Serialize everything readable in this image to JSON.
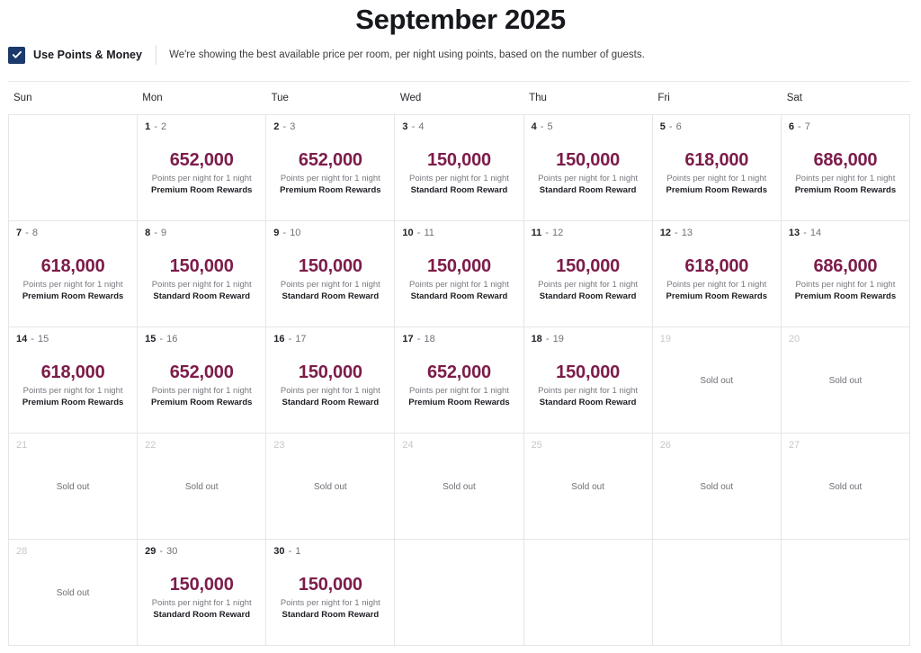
{
  "header": {
    "month_title": "September 2025"
  },
  "points_bar": {
    "checkbox_checked": true,
    "checkbox_icon": "checkmark-icon",
    "label": "Use Points & Money",
    "description": "We're showing the best available price per room, per night using points, based on the number of guests."
  },
  "weekdays": [
    "Sun",
    "Mon",
    "Tue",
    "Wed",
    "Thu",
    "Fri",
    "Sat"
  ],
  "labels": {
    "points_sub": "Points per night for 1 night",
    "sold_out": "Sold out",
    "premium_room": "Premium Room Rewards",
    "standard_room": "Standard Room Reward"
  },
  "colors": {
    "price": "#7c1c4a",
    "checkbox": "#1b3a6b",
    "grid_line": "#e6e6e8",
    "muted_text": "#c6c7cb"
  },
  "calendar": {
    "weeks": [
      [
        {
          "type": "empty"
        },
        {
          "type": "price",
          "day_start": "1",
          "day_end": "2",
          "price": "652,000",
          "sub": "Points per night for 1 night",
          "room": "Premium Room Rewards"
        },
        {
          "type": "price",
          "day_start": "2",
          "day_end": "3",
          "price": "652,000",
          "sub": "Points per night for 1 night",
          "room": "Premium Room Rewards"
        },
        {
          "type": "price",
          "day_start": "3",
          "day_end": "4",
          "price": "150,000",
          "sub": "Points per night for 1 night",
          "room": "Standard Room Reward"
        },
        {
          "type": "price",
          "day_start": "4",
          "day_end": "5",
          "price": "150,000",
          "sub": "Points per night for 1 night",
          "room": "Standard Room Reward"
        },
        {
          "type": "price",
          "day_start": "5",
          "day_end": "6",
          "price": "618,000",
          "sub": "Points per night for 1 night",
          "room": "Premium Room Rewards"
        },
        {
          "type": "price",
          "day_start": "6",
          "day_end": "7",
          "price": "686,000",
          "sub": "Points per night for 1 night",
          "room": "Premium Room Rewards"
        }
      ],
      [
        {
          "type": "price",
          "day_start": "7",
          "day_end": "8",
          "price": "618,000",
          "sub": "Points per night for 1 night",
          "room": "Premium Room Rewards"
        },
        {
          "type": "price",
          "day_start": "8",
          "day_end": "9",
          "price": "150,000",
          "sub": "Points per night for 1 night",
          "room": "Standard Room Reward"
        },
        {
          "type": "price",
          "day_start": "9",
          "day_end": "10",
          "price": "150,000",
          "sub": "Points per night for 1 night",
          "room": "Standard Room Reward"
        },
        {
          "type": "price",
          "day_start": "10",
          "day_end": "11",
          "price": "150,000",
          "sub": "Points per night for 1 night",
          "room": "Standard Room Reward"
        },
        {
          "type": "price",
          "day_start": "11",
          "day_end": "12",
          "price": "150,000",
          "sub": "Points per night for 1 night",
          "room": "Standard Room Reward"
        },
        {
          "type": "price",
          "day_start": "12",
          "day_end": "13",
          "price": "618,000",
          "sub": "Points per night for 1 night",
          "room": "Premium Room Rewards"
        },
        {
          "type": "price",
          "day_start": "13",
          "day_end": "14",
          "price": "686,000",
          "sub": "Points per night for 1 night",
          "room": "Premium Room Rewards"
        }
      ],
      [
        {
          "type": "price",
          "day_start": "14",
          "day_end": "15",
          "price": "618,000",
          "sub": "Points per night for 1 night",
          "room": "Premium Room Rewards"
        },
        {
          "type": "price",
          "day_start": "15",
          "day_end": "16",
          "price": "652,000",
          "sub": "Points per night for 1 night",
          "room": "Premium Room Rewards"
        },
        {
          "type": "price",
          "day_start": "16",
          "day_end": "17",
          "price": "150,000",
          "sub": "Points per night for 1 night",
          "room": "Standard Room Reward"
        },
        {
          "type": "price",
          "day_start": "17",
          "day_end": "18",
          "price": "652,000",
          "sub": "Points per night for 1 night",
          "room": "Premium Room Rewards"
        },
        {
          "type": "price",
          "day_start": "18",
          "day_end": "19",
          "price": "150,000",
          "sub": "Points per night for 1 night",
          "room": "Standard Room Reward"
        },
        {
          "type": "soldout",
          "day_start": "19",
          "status": "Sold out"
        },
        {
          "type": "soldout",
          "day_start": "20",
          "status": "Sold out"
        }
      ],
      [
        {
          "type": "soldout",
          "day_start": "21",
          "status": "Sold out"
        },
        {
          "type": "soldout",
          "day_start": "22",
          "status": "Sold out"
        },
        {
          "type": "soldout",
          "day_start": "23",
          "status": "Sold out"
        },
        {
          "type": "soldout",
          "day_start": "24",
          "status": "Sold out"
        },
        {
          "type": "soldout",
          "day_start": "25",
          "status": "Sold out"
        },
        {
          "type": "soldout",
          "day_start": "26",
          "status": "Sold out"
        },
        {
          "type": "soldout",
          "day_start": "27",
          "status": "Sold out"
        }
      ],
      [
        {
          "type": "soldout",
          "day_start": "28",
          "status": "Sold out"
        },
        {
          "type": "price",
          "day_start": "29",
          "day_end": "30",
          "price": "150,000",
          "sub": "Points per night for 1 night",
          "room": "Standard Room Reward"
        },
        {
          "type": "price",
          "day_start": "30",
          "day_end": "1",
          "price": "150,000",
          "sub": "Points per night for 1 night",
          "room": "Standard Room Reward"
        },
        {
          "type": "empty"
        },
        {
          "type": "empty"
        },
        {
          "type": "empty"
        },
        {
          "type": "empty"
        }
      ]
    ]
  }
}
